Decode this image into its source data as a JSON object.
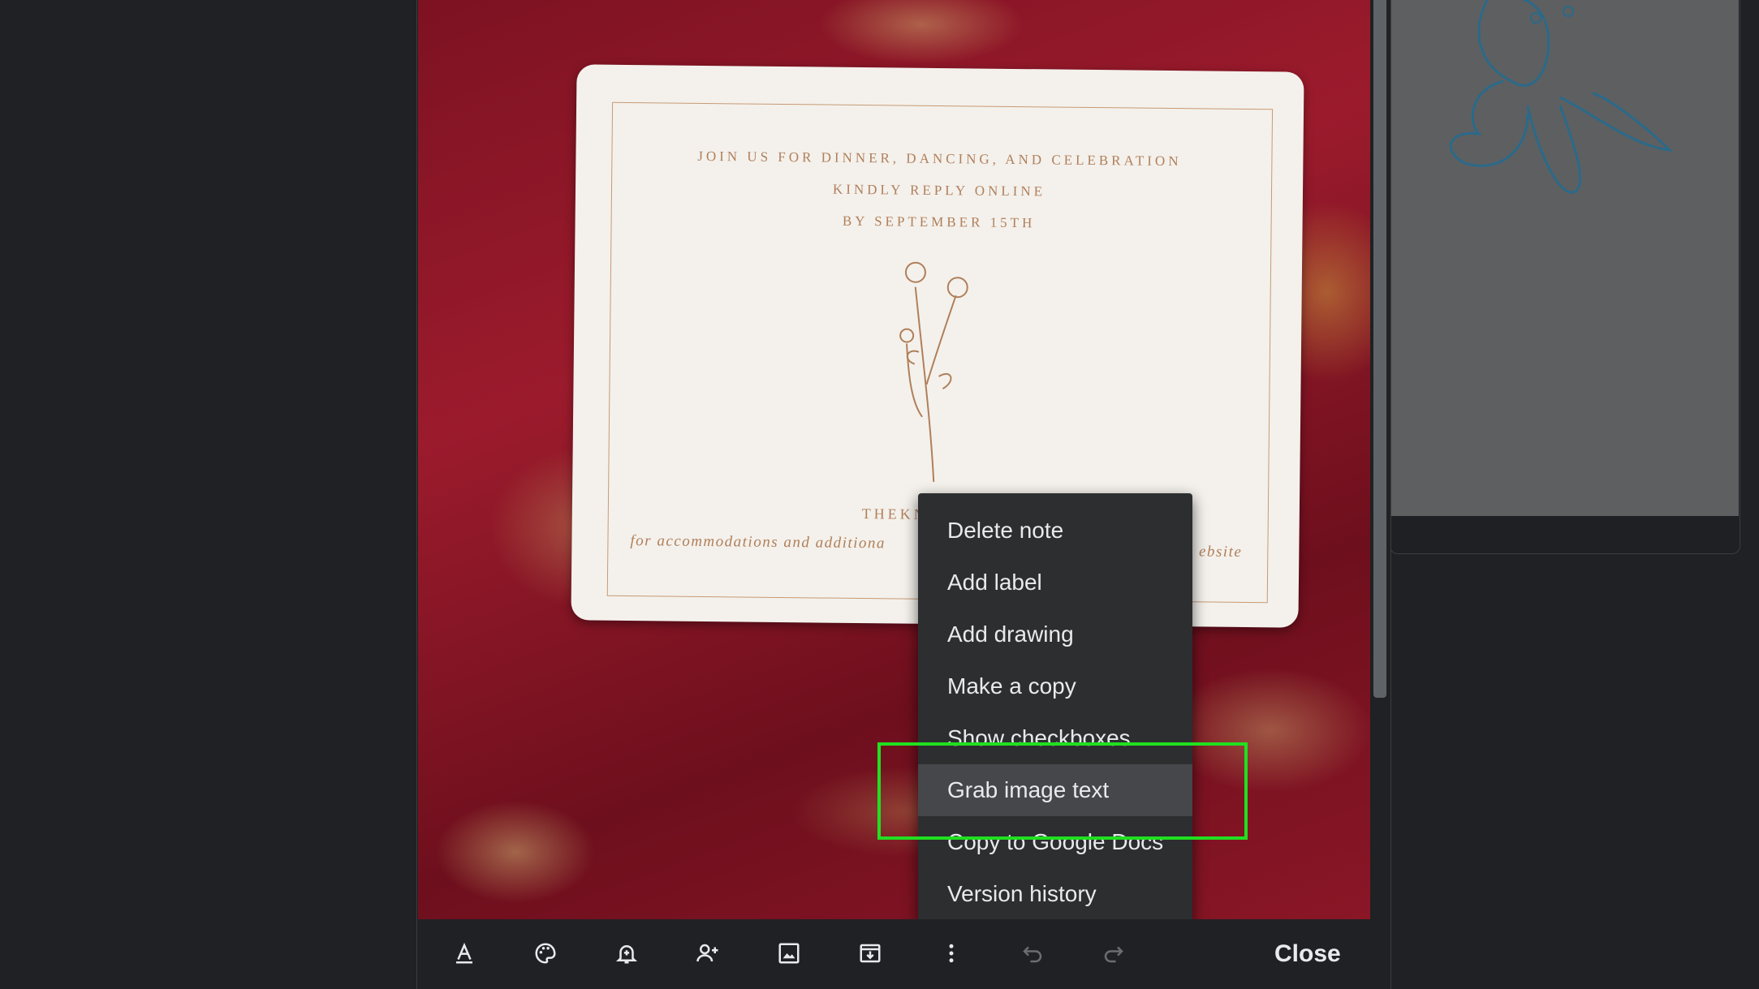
{
  "card": {
    "line1": "JOIN US FOR DINNER, DANCING, AND CELEBRATION",
    "line2": "KINDLY REPLY ONLINE",
    "line3": "BY SEPTEMBER 15TH",
    "url": "THEKNOT.COM/",
    "italic_start": "for accommodations and additiona",
    "italic_end": "ebsite"
  },
  "context_menu": {
    "items": [
      {
        "label": "Delete note"
      },
      {
        "label": "Add label"
      },
      {
        "label": "Add drawing"
      },
      {
        "label": "Make a copy"
      },
      {
        "label": "Show checkboxes"
      },
      {
        "label": "Grab image text"
      },
      {
        "label": "Copy to Google Docs"
      },
      {
        "label": "Version history"
      }
    ],
    "active_index": 5
  },
  "toolbar": {
    "icons": [
      "text-format-icon",
      "palette-icon",
      "reminder-icon",
      "collaborator-icon",
      "image-icon",
      "archive-icon",
      "more-icon",
      "undo-icon",
      "redo-icon"
    ],
    "close_label": "Close"
  },
  "colors": {
    "menu_bg": "#2d2e30",
    "highlight": "#20e020",
    "card_ink": "#b07f5a"
  }
}
